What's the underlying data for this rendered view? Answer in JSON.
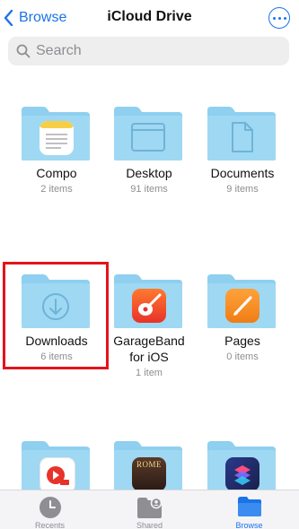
{
  "nav": {
    "back_label": "Browse",
    "title": "iCloud Drive"
  },
  "search": {
    "placeholder": "Search"
  },
  "folders": [
    {
      "name": "Compo",
      "count": "2 items",
      "icon": "notes-doc-icon"
    },
    {
      "name": "Desktop",
      "count": "91 items",
      "icon": "desktop-window-icon"
    },
    {
      "name": "Documents",
      "count": "9 items",
      "icon": "document-icon"
    },
    {
      "name": "Downloads",
      "count": "6 items",
      "icon": "download-arrow-icon"
    },
    {
      "name": "GarageBand for iOS",
      "name_line1": "GarageBand",
      "name_line2": "for iOS",
      "count": "1 item",
      "icon": "garageband-app-icon"
    },
    {
      "name": "Pages",
      "count": "0 items",
      "icon": "pages-app-icon"
    },
    {
      "name": "",
      "count": "",
      "icon": "pdf-expert-app-icon"
    },
    {
      "name": "",
      "count": "",
      "icon": "rome-game-app-icon",
      "icon_text": "ROME"
    },
    {
      "name": "",
      "count": "",
      "icon": "shortcuts-app-icon"
    }
  ],
  "tabbar": {
    "tabs": [
      {
        "label": "Recents",
        "icon": "clock-icon",
        "active": false
      },
      {
        "label": "Shared",
        "icon": "shared-folder-icon",
        "active": false
      },
      {
        "label": "Browse",
        "icon": "folder-icon",
        "active": true
      }
    ]
  },
  "colors": {
    "accent": "#1a73e8",
    "folder": "#8fcff0",
    "highlight": "#e5131a"
  }
}
